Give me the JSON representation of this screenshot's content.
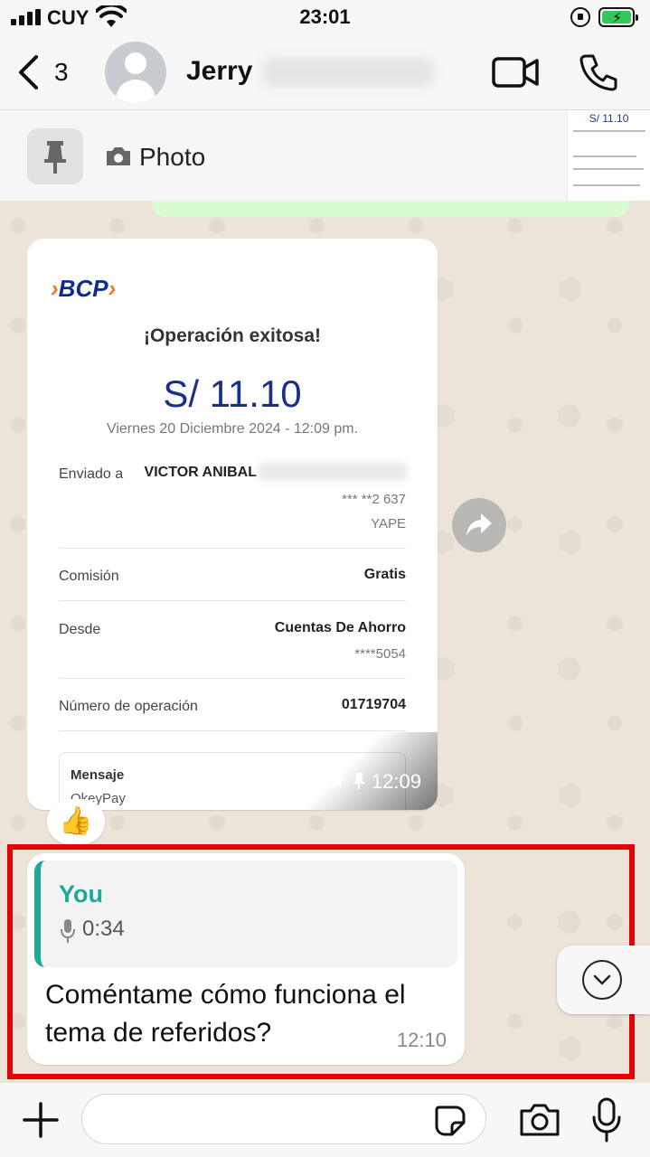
{
  "status_bar": {
    "carrier": "CUY",
    "time": "23:01",
    "battery_charging": true
  },
  "header": {
    "unread_count": "3",
    "contact_name": "Jerry",
    "icons": [
      "back-chevron-icon",
      "avatar",
      "video-call-icon",
      "phone-icon"
    ]
  },
  "pinned": {
    "label": "Photo",
    "thumb_amount": "S/ 11.10"
  },
  "receipt": {
    "brand": "BCP",
    "title": "¡Operación exitosa!",
    "amount": "S/ 11.10",
    "date": "Viernes 20 Diciembre 2024 - 12:09 pm.",
    "rows": {
      "sent_to_label": "Enviado a",
      "sent_to_value": "VICTOR ANIBAL",
      "sent_to_phone": "*** **2 637",
      "sent_to_app": "YAPE",
      "fee_label": "Comisión",
      "fee_value": "Gratis",
      "from_label": "Desde",
      "from_value": "Cuentas De Ahorro",
      "from_account": "****5054",
      "op_number_label": "Número de operación",
      "op_number_value": "01719704",
      "message_label": "Mensaje",
      "message_value": "OkeyPay"
    },
    "time": "12:09",
    "starred": true,
    "pinned": true
  },
  "reaction": "👍",
  "reply_message": {
    "quoted_author": "You",
    "quoted_duration": "0:34",
    "text": "Coméntame cómo funciona el tema de referidos?",
    "time": "12:10"
  },
  "input": {
    "placeholder": ""
  },
  "colors": {
    "accent_teal": "#1fa79a",
    "bcp_blue": "#1a2f8a",
    "bcp_orange": "#f47920",
    "highlight_red": "#e60000",
    "outgoing_green": "#d9fdd3"
  }
}
